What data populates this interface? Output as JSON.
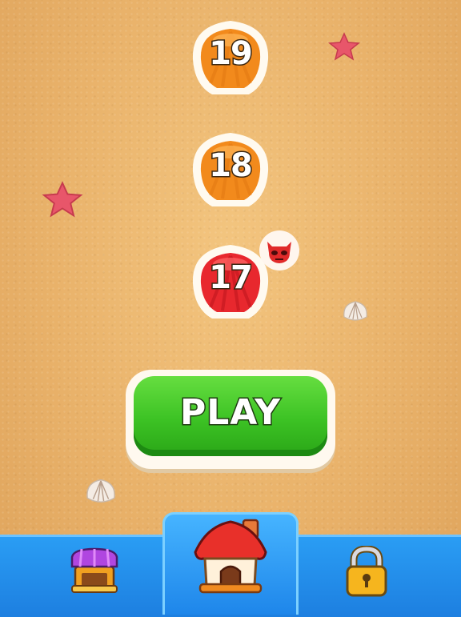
{
  "levels": [
    {
      "number": "19",
      "state": "normal",
      "color": "#f28a1c"
    },
    {
      "number": "18",
      "state": "normal",
      "color": "#f28a1c"
    },
    {
      "number": "17",
      "state": "hard",
      "color": "#e8282e"
    }
  ],
  "play_button": {
    "label": "PLAY"
  },
  "colors": {
    "sand": "#eab46b",
    "play_green": "#3cc224",
    "nav_blue": "#2a9df4",
    "shell_orange": "#f28a1c",
    "shell_red": "#e8282e"
  },
  "bottom_nav": [
    {
      "icon": "shop-icon",
      "active": false
    },
    {
      "icon": "home-icon",
      "active": true
    },
    {
      "icon": "lock-icon",
      "active": false
    }
  ],
  "decorations": [
    "starfish-icon",
    "starfish-icon",
    "seashell-icon",
    "seashell-icon"
  ],
  "badges": {
    "hard_level_icon": "skull-devil-icon"
  }
}
